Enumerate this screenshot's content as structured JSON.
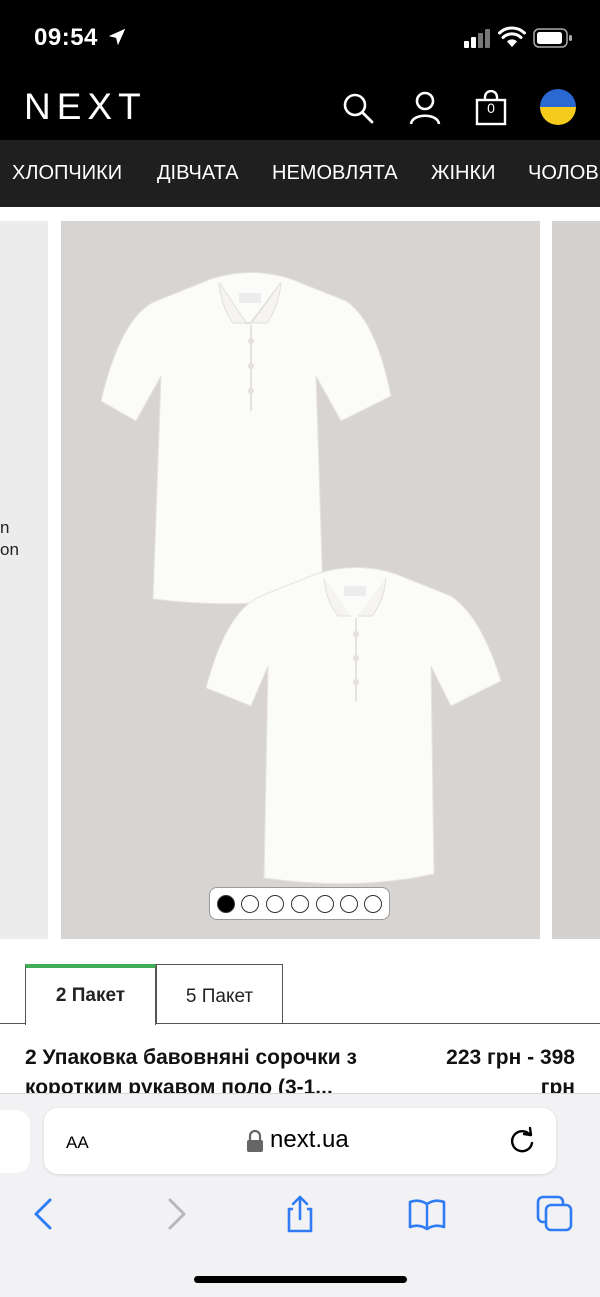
{
  "status_bar": {
    "time": "09:54",
    "icons": [
      "location-arrow-icon",
      "signal-icon",
      "wifi-icon",
      "battery-icon"
    ]
  },
  "header": {
    "logo": "NEXT",
    "bag_count": "0",
    "icons": [
      "search-icon",
      "account-icon",
      "bag-icon",
      "ukraine-flag-icon"
    ],
    "flag_colors": [
      "#2b69d2",
      "#f6cc1c"
    ]
  },
  "categories": [
    "ХЛОПЧИКИ",
    "ДІВЧАТА",
    "НЕМОВЛЯТА",
    "ЖІНКИ",
    "ЧОЛОВ"
  ],
  "gallery": {
    "prev_card_text": [
      "n",
      "on"
    ],
    "image_count": 7,
    "active_index": 0
  },
  "tabs": [
    {
      "label": "2 Пакет",
      "active": true
    },
    {
      "label": "5 Пакет",
      "active": false
    }
  ],
  "colors": {
    "active_tab_accent": "#3fae56",
    "header_bg": "#000000",
    "nav_bg": "#1f1f1f"
  },
  "product": {
    "title": "2 Упаковка бавовняні сорочки з коротким рукавом поло (3-1...",
    "price": "223 грн - 398 грн"
  },
  "browser": {
    "aa_label": "AA",
    "url": "next.ua",
    "toolbar": [
      "back-icon",
      "forward-icon",
      "share-icon",
      "bookmarks-icon",
      "tabs-icon"
    ]
  }
}
